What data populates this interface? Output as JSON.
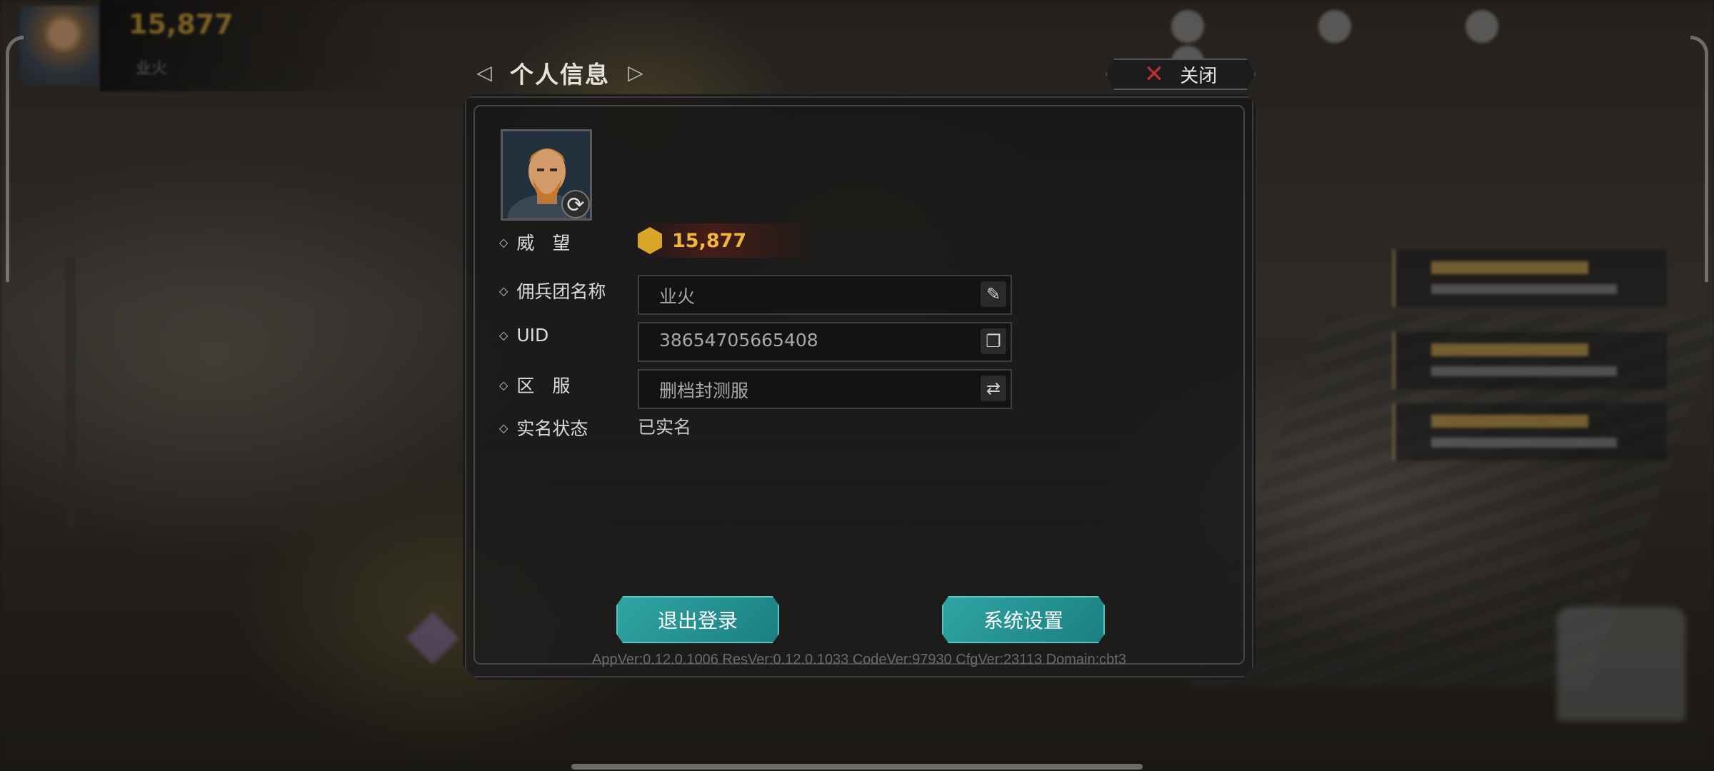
{
  "hud": {
    "resource_value": "15,877",
    "player_name": "业火"
  },
  "dialog": {
    "title": "个人信息",
    "close_label": "关闭",
    "prestige": {
      "label": "威　望",
      "value": "15,877"
    },
    "team_name": {
      "label": "佣兵团名称",
      "value": "业火"
    },
    "uid": {
      "label": "UID",
      "value": "38654705665408"
    },
    "server": {
      "label": "区　服",
      "value": "删档封测服"
    },
    "real_name": {
      "label": "实名状态",
      "value": "已实名"
    },
    "logout_label": "退出登录",
    "settings_label": "系统设置",
    "version": "AppVer:0.12.0.1006  ResVer:0.12.0.1033  CodeVer:97930  CfgVer:23113  Domain:cbt3"
  },
  "icons": {
    "prev": "triangle-left-icon",
    "next": "triangle-right-icon",
    "close": "x-icon",
    "refresh": "refresh-icon",
    "edit": "quill-icon",
    "copy": "copy-icon",
    "swap": "swap-icon",
    "prestige": "prestige-crown-icon"
  },
  "colors": {
    "accent": "#2fa5a3",
    "gold": "#f2b73a",
    "close_red": "#c22b2b"
  }
}
